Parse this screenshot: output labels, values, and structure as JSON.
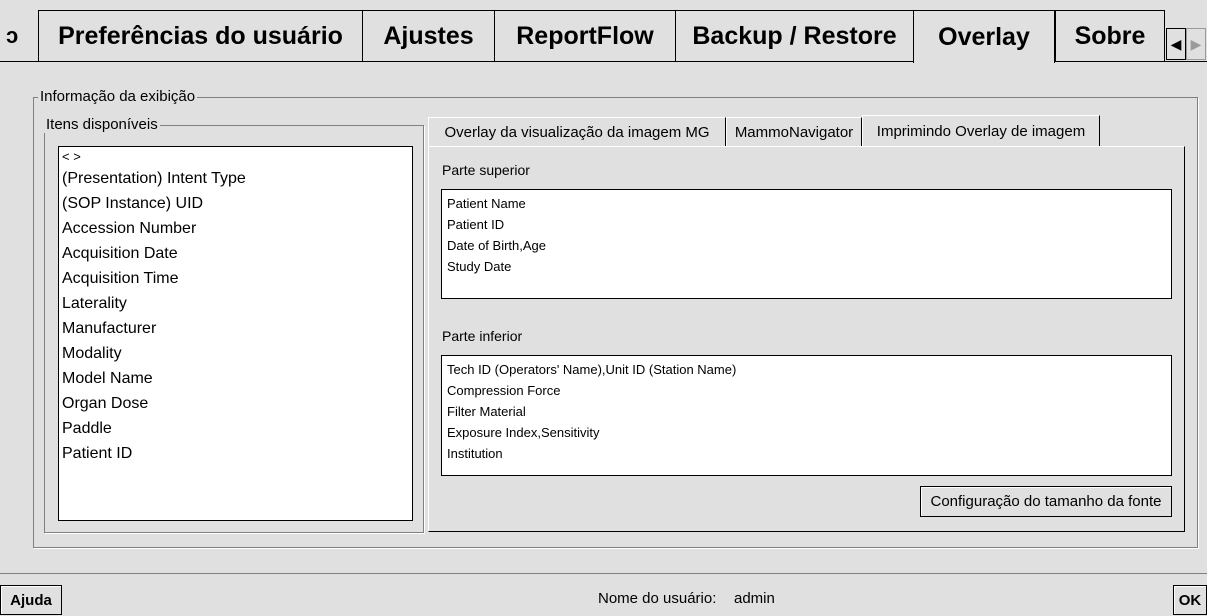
{
  "top_tabs": {
    "edge_glyph": "ↄ",
    "items": [
      {
        "label": "Preferências do usuário",
        "active": false
      },
      {
        "label": "Ajustes",
        "active": false
      },
      {
        "label": "ReportFlow",
        "active": false
      },
      {
        "label": "Backup / Restore",
        "active": false
      },
      {
        "label": "Overlay",
        "active": true
      },
      {
        "label": "Sobre",
        "active": false
      }
    ],
    "scroll_left_icon": "◀",
    "scroll_right_icon": "▶"
  },
  "display_info": {
    "title": "Informação da exibição",
    "available": {
      "title": "Itens disponíveis",
      "items": [
        "< >",
        "(Presentation) Intent Type",
        "(SOP Instance) UID",
        "Accession Number",
        "Acquisition Date",
        "Acquisition Time",
        "Laterality",
        "Manufacturer",
        "Modality",
        "Model Name",
        "Organ Dose",
        "Paddle",
        "Patient ID"
      ]
    },
    "inner_tabs": [
      {
        "label": "Overlay da visualização da imagem MG",
        "active": false
      },
      {
        "label": "MammoNavigator",
        "active": false
      },
      {
        "label": "Imprimindo Overlay de imagem",
        "active": true
      }
    ],
    "top_section": {
      "label": "Parte superior",
      "items": [
        "Patient Name",
        "Patient ID",
        "Date of Birth,Age",
        "Study Date"
      ]
    },
    "bottom_section": {
      "label": "Parte inferior",
      "items": [
        "Tech ID (Operators' Name),Unit ID (Station Name)",
        "Compression Force",
        "Filter Material",
        "Exposure Index,Sensitivity",
        "Institution"
      ]
    },
    "font_size_button": "Configuração do tamanho da fonte"
  },
  "footer": {
    "help_button": "Ajuda",
    "user_label": "Nome do usuário:",
    "user_name": "admin",
    "ok_button": "OK"
  }
}
